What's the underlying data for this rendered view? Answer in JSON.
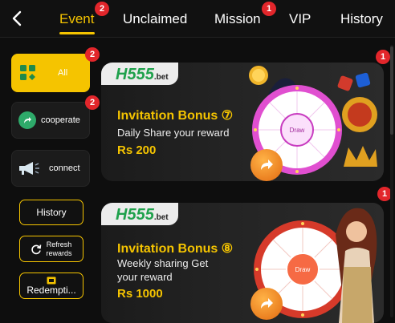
{
  "header": {
    "tabs": [
      {
        "label": "Event",
        "badge": "2",
        "active": true
      },
      {
        "label": "Unclaimed",
        "badge": ""
      },
      {
        "label": "Mission",
        "badge": "1"
      },
      {
        "label": "VIP",
        "badge": ""
      },
      {
        "label": "History",
        "badge": ""
      }
    ]
  },
  "sidebar": {
    "categories": [
      {
        "label": "All",
        "badge": "2",
        "icon": "grid-icon"
      },
      {
        "label": "cooperate",
        "badge": "2",
        "icon": "share-icon"
      },
      {
        "label": "connect",
        "badge": "",
        "icon": "megaphone-icon"
      }
    ],
    "buttons": {
      "history": "History",
      "refresh_line1": "Refresh",
      "refresh_line2": "rewards",
      "redemption": "Redempti..."
    }
  },
  "banners": [
    {
      "badge": "1",
      "logo": "H555",
      "logo_suffix": ".bet",
      "title": "Invitation Bonus ⑦",
      "subtitle": "Daily Share your reward",
      "amount": "Rs 200",
      "wheel_center": "Draw"
    },
    {
      "badge": "1",
      "logo": "H555",
      "logo_suffix": ".bet",
      "title": "Invitation Bonus ⑧",
      "subtitle_line1": "Weekly sharing Get",
      "subtitle_line2": "your reward",
      "amount": "Rs 1000",
      "wheel_center": "Draw"
    }
  ],
  "colors": {
    "accent": "#f5c400",
    "badge": "#e2262b",
    "background": "#0e0e0e"
  }
}
